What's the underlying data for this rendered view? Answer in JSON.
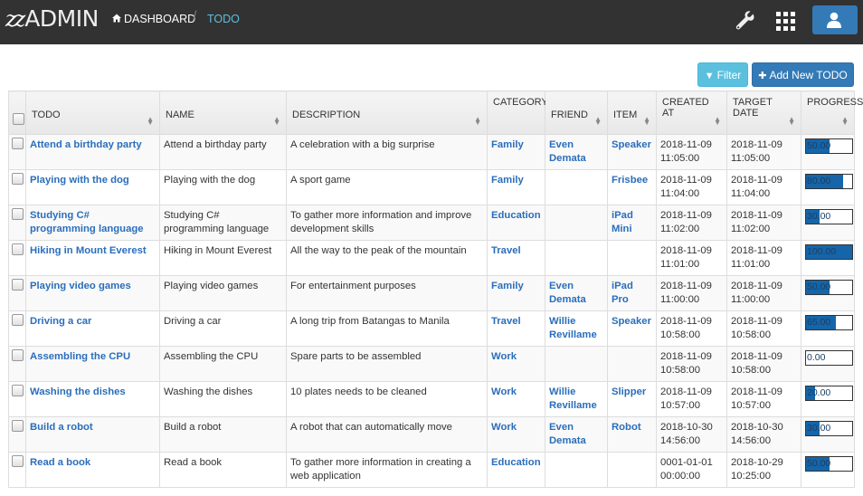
{
  "app": {
    "logo_prefix": "zz",
    "logo_text": "ADMIN"
  },
  "breadcrumb": {
    "home_label": "DASHBOARD",
    "separator": "/",
    "current_label": "TODO"
  },
  "toolbar": {
    "filter_label": "Filter",
    "add_label": "Add New TODO"
  },
  "table": {
    "headers": {
      "todo": "TODO",
      "name": "NAME",
      "description": "DESCRIPTION",
      "category": "CATEGORY",
      "friend": "FRIEND",
      "item": "ITEM",
      "created_at": "CREATED AT",
      "target_date": "TARGET DATE",
      "progress": "PROGRESS"
    },
    "rows": [
      {
        "todo": "Attend a birthday party",
        "name": "Attend a birthday party",
        "description": "A celebration with a big surprise",
        "category": "Family",
        "friend": "Even Demata",
        "item": "Speaker",
        "created_at": "2018-11-09 11:05:00",
        "target_date": "2018-11-09 11:05:00",
        "progress": "50.00",
        "progress_value": 50
      },
      {
        "todo": "Playing with the dog",
        "name": "Playing with the dog",
        "description": "A sport game",
        "category": "Family",
        "friend": "",
        "item": "Frisbee",
        "created_at": "2018-11-09 11:04:00",
        "target_date": "2018-11-09 11:04:00",
        "progress": "80.00",
        "progress_value": 80
      },
      {
        "todo": "Studying C# programming language",
        "name": "Studying C# programming language",
        "description": "To gather more information and improve development skills",
        "category": "Education",
        "friend": "",
        "item": "iPad Mini",
        "created_at": "2018-11-09 11:02:00",
        "target_date": "2018-11-09 11:02:00",
        "progress": "30.00",
        "progress_value": 30
      },
      {
        "todo": "Hiking in Mount Everest",
        "name": "Hiking in Mount Everest",
        "description": "All the way to the peak of the mountain",
        "category": "Travel",
        "friend": "",
        "item": "",
        "created_at": "2018-11-09 11:01:00",
        "target_date": "2018-11-09 11:01:00",
        "progress": "100.00",
        "progress_value": 100
      },
      {
        "todo": "Playing video games",
        "name": "Playing video games",
        "description": "For entertainment purposes",
        "category": "Family",
        "friend": "Even Demata",
        "item": "iPad Pro",
        "created_at": "2018-11-09 11:00:00",
        "target_date": "2018-11-09 11:00:00",
        "progress": "50.00",
        "progress_value": 50
      },
      {
        "todo": "Driving a car",
        "name": "Driving a car",
        "description": "A long trip from Batangas to Manila",
        "category": "Travel",
        "friend": "Willie Revillame",
        "item": "Speaker",
        "created_at": "2018-11-09 10:58:00",
        "target_date": "2018-11-09 10:58:00",
        "progress": "65.00",
        "progress_value": 65
      },
      {
        "todo": "Assembling the CPU",
        "name": "Assembling the CPU",
        "description": "Spare parts to be assembled",
        "category": "Work",
        "friend": "",
        "item": "",
        "created_at": "2018-11-09 10:58:00",
        "target_date": "2018-11-09 10:58:00",
        "progress": "0.00",
        "progress_value": 0
      },
      {
        "todo": "Washing the dishes",
        "name": "Washing the dishes",
        "description": "10 plates needs to be cleaned",
        "category": "Work",
        "friend": "Willie Revillame",
        "item": "Slipper",
        "created_at": "2018-11-09 10:57:00",
        "target_date": "2018-11-09 10:57:00",
        "progress": "20.00",
        "progress_value": 20
      },
      {
        "todo": "Build a robot",
        "name": "Build a robot",
        "description": "A robot that can automatically move",
        "category": "Work",
        "friend": "Even Demata",
        "item": "Robot",
        "created_at": "2018-10-30 14:56:00",
        "target_date": "2018-10-30 14:56:00",
        "progress": "30.00",
        "progress_value": 30
      },
      {
        "todo": "Read a book",
        "name": "Read a book",
        "description": "To gather more information in creating a web application",
        "category": "Education",
        "friend": "",
        "item": "",
        "created_at": "0001-01-01 00:00:00",
        "target_date": "2018-10-29 10:25:00",
        "progress": "50.00",
        "progress_value": 50
      }
    ]
  },
  "icons": {
    "home": "home-icon",
    "wrench": "wrench-icon",
    "apps": "grid-icon",
    "user": "user-icon",
    "filter": "filter-icon",
    "add": "plus-icon"
  },
  "colors": {
    "navbar": "#323232",
    "link": "#2a6ebb",
    "primary": "#337ab7",
    "info": "#5bc0de",
    "progress_fill": "#1565a8"
  }
}
